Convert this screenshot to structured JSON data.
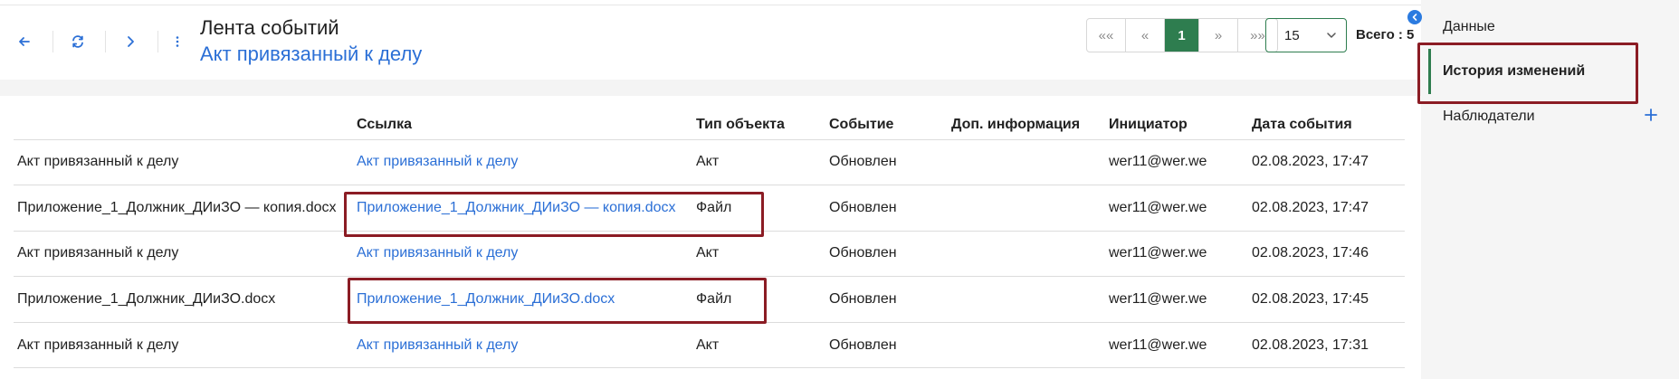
{
  "header": {
    "title": "Лента событий",
    "subtitle": "Акт привязанный к делу"
  },
  "pagination": {
    "first": "««",
    "prev": "«",
    "current": "1",
    "next": "»",
    "last": "»»",
    "page_size": "15",
    "total": "Всего : 5"
  },
  "table": {
    "columns": [
      "",
      "Ссылка",
      "Тип объекта",
      "Событие",
      "Доп. информация",
      "Инициатор",
      "Дата события"
    ],
    "rows": [
      {
        "name": "Акт привязанный к делу",
        "link": "Акт привязанный к делу",
        "type": "Акт",
        "event": "Обновлен",
        "info": "",
        "initiator": "wer11@wer.we",
        "date": "02.08.2023, 17:47"
      },
      {
        "name": "Приложение_1_Должник_ДИиЗО — копия.docx",
        "link": "Приложение_1_Должник_ДИиЗО — копия.docx",
        "type": "Файл",
        "event": "Обновлен",
        "info": "",
        "initiator": "wer11@wer.we",
        "date": "02.08.2023, 17:47"
      },
      {
        "name": "Акт привязанный к делу",
        "link": "Акт привязанный к делу",
        "type": "Акт",
        "event": "Обновлен",
        "info": "",
        "initiator": "wer11@wer.we",
        "date": "02.08.2023, 17:46"
      },
      {
        "name": "Приложение_1_Должник_ДИиЗО.docx",
        "link": "Приложение_1_Должник_ДИиЗО.docx",
        "type": "Файл",
        "event": "Обновлен",
        "info": "",
        "initiator": "wer11@wer.we",
        "date": "02.08.2023, 17:45"
      },
      {
        "name": "Акт привязанный к делу",
        "link": "Акт привязанный к делу",
        "type": "Акт",
        "event": "Обновлен",
        "info": "",
        "initiator": "wer11@wer.we",
        "date": "02.08.2023, 17:31"
      }
    ]
  },
  "side_panel": {
    "items": [
      {
        "label": "Данные"
      },
      {
        "label": "История изменений",
        "active": true
      },
      {
        "label": "Наблюдатели"
      }
    ]
  },
  "icons": {
    "back": "arrow-left-icon",
    "refresh": "refresh-icon",
    "forward": "chevron-right-icon",
    "more": "more-vertical-icon",
    "collapse": "chevron-left-icon",
    "add": "plus-icon"
  },
  "colors": {
    "accent_green": "#2e7d4f",
    "link_blue": "#2b6fd6",
    "highlight": "#8b1c24"
  }
}
